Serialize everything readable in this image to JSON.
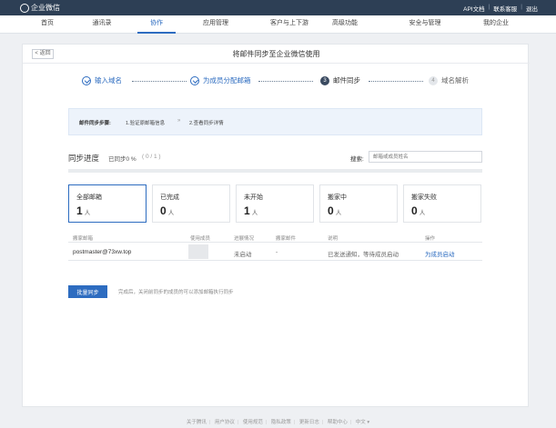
{
  "brand": {
    "name": "企业微信"
  },
  "top_links": [
    "API文档",
    "联系客服",
    "退出"
  ],
  "nav": {
    "items": [
      {
        "label": "首页"
      },
      {
        "label": "通讯录"
      },
      {
        "label": "协作"
      },
      {
        "label": "应用管理"
      },
      {
        "label": "客户与上下游"
      },
      {
        "label": "高级功能"
      },
      {
        "label": "安全与管理"
      },
      {
        "label": "我的企业"
      }
    ],
    "active_index": 2
  },
  "page": {
    "back_label": "< 返回",
    "title": "将邮件同步至企业微信使用"
  },
  "steps": [
    {
      "num": "",
      "label": "输入域名",
      "state": "done"
    },
    {
      "num": "",
      "label": "为成员分配邮箱",
      "state": "done"
    },
    {
      "num": "3",
      "label": "邮件同步",
      "state": "current"
    },
    {
      "num": "4",
      "label": "域名解析",
      "state": "pending"
    }
  ],
  "info": {
    "label": "邮件同步步骤:",
    "step1": "1.验证原邮箱信息",
    "arrow": "»",
    "step2": "2.查看同步详情"
  },
  "sync": {
    "title": "同步进度",
    "status": "已同步0 %",
    "count": "( 0 / 1 )",
    "progress_pct": 0,
    "search_label": "搜索:",
    "search_placeholder": "邮箱或成员姓名"
  },
  "stats": [
    {
      "label": "全部邮箱",
      "value": "1",
      "unit": "人"
    },
    {
      "label": "已完成",
      "value": "0",
      "unit": "人"
    },
    {
      "label": "未开始",
      "value": "1",
      "unit": "人"
    },
    {
      "label": "搬家中",
      "value": "0",
      "unit": "人"
    },
    {
      "label": "搬家失败",
      "value": "0",
      "unit": "人"
    }
  ],
  "table": {
    "headers": [
      "搬家邮箱",
      "使用成员",
      "进展情况",
      "搬家邮件",
      "说明",
      "操作"
    ],
    "rows": [
      {
        "mailbox": "postmaster@73xw.top",
        "member": "",
        "status": "未启动",
        "mails": "-",
        "note": "已发送通知，等待成员启动",
        "action": "为成员启动"
      }
    ]
  },
  "actions": {
    "primary_label": "批量同步",
    "hint": "完成后，关闭前同步的成员的可以添加邮箱执行同步"
  },
  "footer": {
    "links": [
      "关于腾讯",
      "用户协议",
      "使用规范",
      "隐私政策",
      "更新日志",
      "帮助中心",
      "中文 ▾"
    ]
  }
}
